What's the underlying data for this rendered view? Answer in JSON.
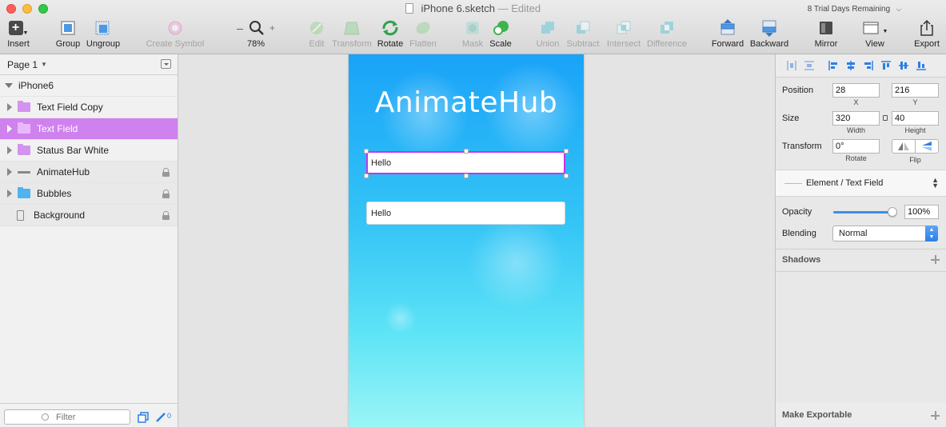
{
  "window": {
    "title": "iPhone 6.sketch",
    "title_sep": "—",
    "status": "Edited",
    "trial": "8 Trial Days Remaining"
  },
  "toolbar": {
    "insert": "Insert",
    "group": "Group",
    "ungroup": "Ungroup",
    "create_symbol": "Create Symbol",
    "zoom": "78%",
    "zoom_minus": "–",
    "zoom_plus": "+",
    "edit": "Edit",
    "transform": "Transform",
    "rotate": "Rotate",
    "flatten": "Flatten",
    "mask": "Mask",
    "scale": "Scale",
    "union": "Union",
    "subtract": "Subtract",
    "intersect": "Intersect",
    "difference": "Difference",
    "forward": "Forward",
    "backward": "Backward",
    "mirror": "Mirror",
    "view": "View",
    "export": "Export"
  },
  "layers": {
    "page": "Page 1",
    "artboard": "iPhone6",
    "items": [
      {
        "name": "Text Field Copy"
      },
      {
        "name": "Text Field"
      },
      {
        "name": "Status Bar White"
      },
      {
        "name": "AnimateHub"
      },
      {
        "name": "Bubbles"
      },
      {
        "name": "Background"
      }
    ],
    "filter_placeholder": "Filter",
    "slice_count": "0"
  },
  "canvas": {
    "app_title": "AnimateHub",
    "field1": "Hello",
    "field2": "Hello"
  },
  "inspector": {
    "position_label": "Position",
    "x": "28",
    "y": "216",
    "x_label": "X",
    "y_label": "Y",
    "size_label": "Size",
    "width": "320",
    "height": "40",
    "width_label": "Width",
    "height_label": "Height",
    "transform_label": "Transform",
    "rotate": "0°",
    "rotate_label": "Rotate",
    "flip_label": "Flip",
    "style": "Element / Text Field",
    "opacity_label": "Opacity",
    "opacity": "100%",
    "blending_label": "Blending",
    "blending": "Normal",
    "shadows": "Shadows",
    "make_exportable": "Make Exportable"
  },
  "colors": {
    "selection": "#cf81ee",
    "accent": "#3c8ee6",
    "artboard_top": "#1aa3f8",
    "artboard_bottom": "#9af5f6"
  }
}
